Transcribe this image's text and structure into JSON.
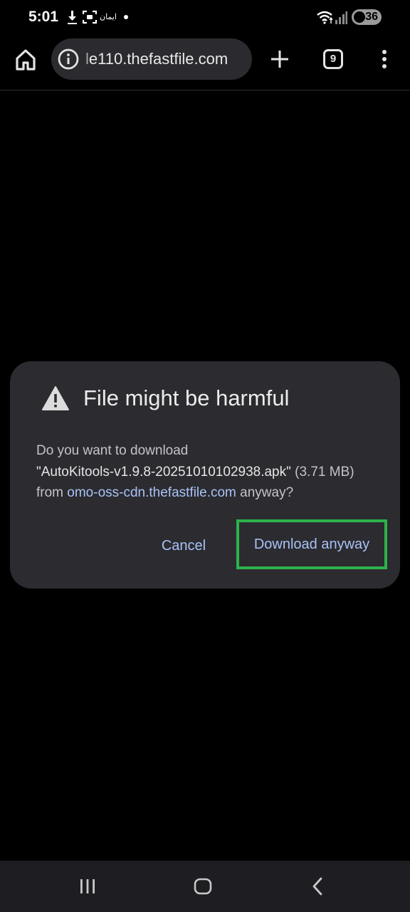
{
  "status_bar": {
    "time": "5:01",
    "notification_text": "ايمان",
    "battery_level": "36",
    "icons": [
      "download-icon",
      "screenshot-icon",
      "wifi-icon",
      "signal-icon",
      "battery-saver-icon"
    ]
  },
  "toolbar": {
    "url": "le110.thefastfile.com",
    "tab_count": "9",
    "icons": [
      "home-icon",
      "info-icon",
      "plus-icon",
      "tabs-icon",
      "more-vert-icon"
    ]
  },
  "dialog": {
    "title": "File might be harmful",
    "body_prefix": "Do you want to download",
    "file_name": "\"AutoKitools-v1.9.8-20251010102938.apk\"",
    "file_size": " (3.71 MB) from ",
    "source_domain": "omo-oss-cdn.thefastfile.com",
    "body_suffix": " anyway?",
    "cancel_label": "Cancel",
    "download_label": "Download anyway",
    "icon": "warning-icon",
    "highlight_color": "#2db24a",
    "accent_color": "#a9c2f5"
  },
  "nav_bar": {
    "icons": [
      "recents-icon",
      "home-nav-icon",
      "back-icon"
    ]
  }
}
